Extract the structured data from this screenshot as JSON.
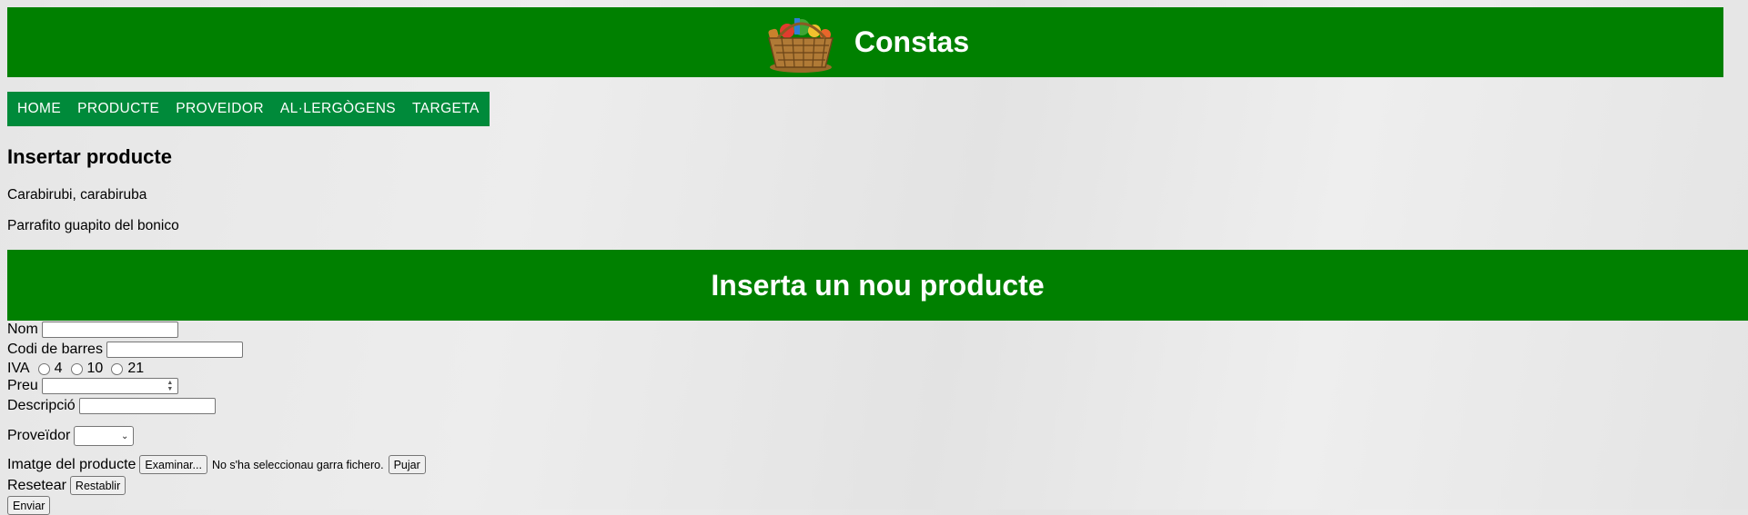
{
  "header": {
    "site_title": "Constas",
    "logo_icon": "shopping-basket-icon",
    "brand_color": "#008000"
  },
  "nav": {
    "color": "#008a3a",
    "items": [
      {
        "label": "HOME"
      },
      {
        "label": "PRODUCTE"
      },
      {
        "label": "PROVEIDOR"
      },
      {
        "label": "AL·LERGÒGENS"
      },
      {
        "label": "TARGETA"
      }
    ]
  },
  "main": {
    "title": "Insertar producte",
    "paragraph1": "Carabirubi, carabiruba",
    "paragraph2": "Parrafito guapito del bonico",
    "section_title": "Inserta un nou producte"
  },
  "form": {
    "nom": {
      "label": "Nom",
      "value": ""
    },
    "codi": {
      "label": "Codi de barres",
      "value": ""
    },
    "iva": {
      "label": "IVA",
      "options": [
        "4",
        "10",
        "21"
      ]
    },
    "preu": {
      "label": "Preu",
      "value": ""
    },
    "descripcio": {
      "label": "Descripció",
      "value": ""
    },
    "proveidor": {
      "label": "Proveïdor",
      "selected": ""
    },
    "imatge": {
      "label": "Imatge del producte",
      "browse_label": "Examinar...",
      "status": "No s'ha seleccionau garra fichero.",
      "upload_label": "Pujar"
    },
    "reset": {
      "label": "Resetear",
      "button_label": "Restablir"
    },
    "submit_label": "Enviar"
  }
}
